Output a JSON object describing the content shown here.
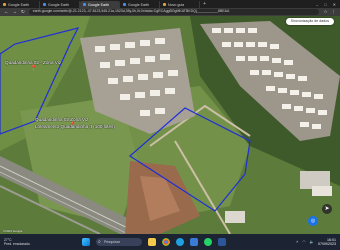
{
  "browser": {
    "tabs": [
      {
        "label": "Google Earth",
        "active": false
      },
      {
        "label": "Google Earth",
        "active": false
      },
      {
        "label": "Google Earth",
        "active": true
      },
      {
        "label": "Google Earth",
        "active": false
      },
      {
        "label": "Novo guia",
        "active": false
      }
    ],
    "url": "earth.google.com/web/@-21.2123,-47.8123,545.21a,1523d,35y,0h,0t,0r/data=CgRCAggBOgMKATBKDQj___________8BEAA"
  },
  "map": {
    "earth_button": "Sincronização de dados",
    "labels": {
      "area1": "Quadandinha 02  -  Zona Viz",
      "area2_line1": "Quadandinha 02 Zona Viz",
      "area2_line2": "Loteamento Quadandinha II (100 lotes)"
    },
    "status": "©2023 Google",
    "colors": {
      "polygon": "#1f2fd8"
    }
  },
  "taskbar": {
    "weather_line1": "27°C",
    "weather_line2": "Pred. ensolarado",
    "search_placeholder": "Pesquisar",
    "time": "16:01",
    "date": "07/09/2023",
    "icons": [
      "windows-start-icon",
      "file-explorer-icon",
      "chrome-icon",
      "edge-icon",
      "store-icon",
      "whatsapp-icon",
      "word-icon"
    ]
  }
}
